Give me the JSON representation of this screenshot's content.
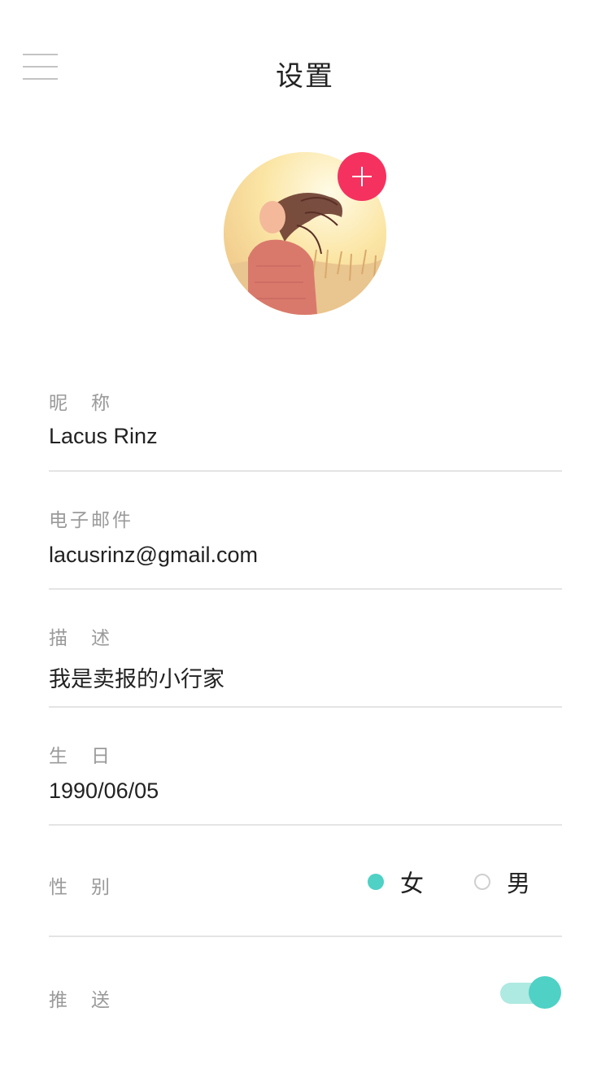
{
  "header": {
    "title": "设置",
    "menu_icon": "hamburger-menu-icon"
  },
  "avatar": {
    "add_icon": "plus-icon",
    "accent_color": "#f5325f"
  },
  "form": {
    "nickname": {
      "label": "昵　称",
      "value": "Lacus Rinz"
    },
    "email": {
      "label": "电子邮件",
      "value": "lacusrinz@gmail.com"
    },
    "description": {
      "label": "描　述",
      "value": "我是卖报的小行家"
    },
    "birthday": {
      "label": "生　日",
      "value": "1990/06/05"
    },
    "gender": {
      "label": "性　别",
      "options": [
        {
          "label": "女",
          "selected": true
        },
        {
          "label": "男",
          "selected": false
        }
      ]
    },
    "push": {
      "label": "推　送",
      "enabled": true
    }
  },
  "colors": {
    "accent": "#4fd1c5",
    "accent_light": "#aee9e2",
    "label": "#9a9a9a",
    "divider": "#e4e4e4"
  }
}
